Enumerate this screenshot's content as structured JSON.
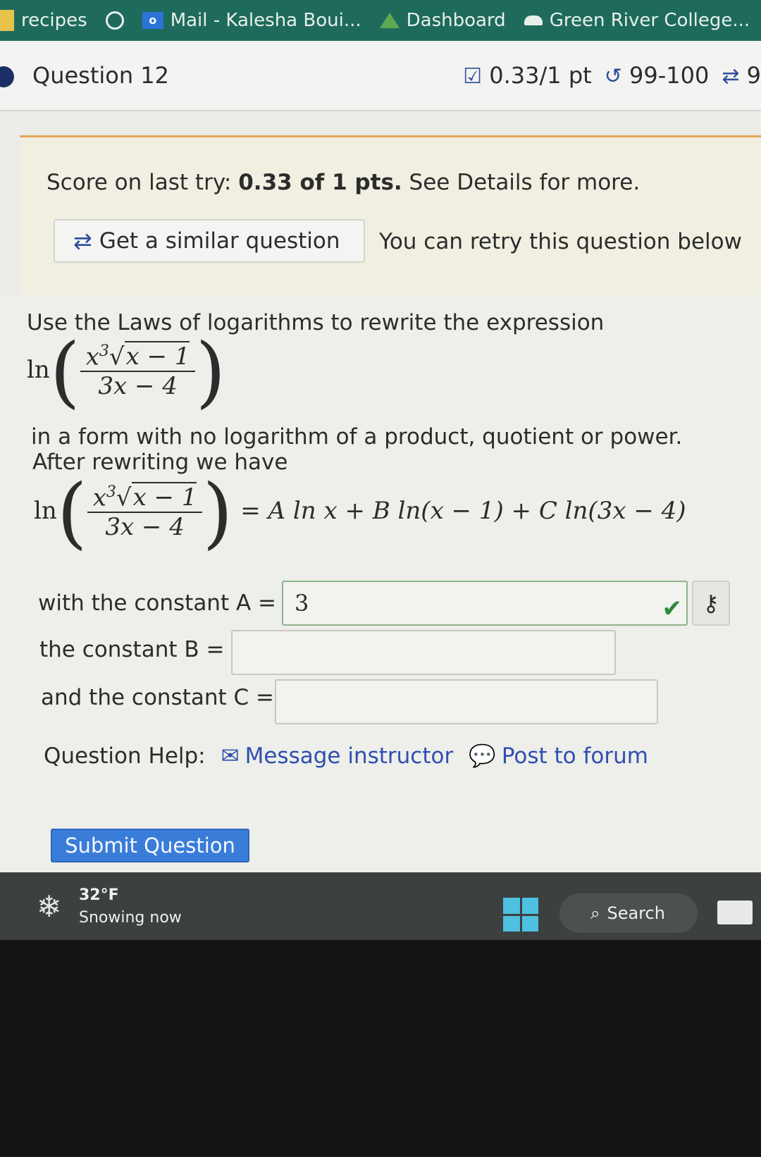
{
  "bookmarks": [
    {
      "label": "recipes",
      "icon": "folder-icon"
    },
    {
      "label": "",
      "icon": "circle-icon"
    },
    {
      "label": "Mail - Kalesha Boui...",
      "icon": "outlook-icon"
    },
    {
      "label": "Dashboard",
      "icon": "canvas-icon"
    },
    {
      "label": "Green River College...",
      "icon": "cloud-icon"
    }
  ],
  "question": {
    "title": "Question 12",
    "score": "0.33/1 pt",
    "attempts": "99-100",
    "retries": "9"
  },
  "score_box": {
    "prefix": "Score on last try: ",
    "score_bold": "0.33 of 1 pts.",
    "suffix": " See Details for more.",
    "similar_button": "Get a similar question",
    "retry_text": "You can retry this question below"
  },
  "problem": {
    "intro": "Use the Laws of logarithms to rewrite the expression",
    "ln": "ln",
    "numerator": "x",
    "numerator_exp": "3",
    "sqrt_content": "x − 1",
    "denominator": "3x − 4",
    "line2": "in a form with no logarithm of a product, quotient or power.",
    "line3": "After rewriting we have",
    "rhs": "= A ln x + B ln(x − 1) + C ln(3x − 4)",
    "label_a": "with the constant A =",
    "value_a": "3",
    "label_b": "the constant B =",
    "value_b": "",
    "label_c": "and the constant C =",
    "value_c": ""
  },
  "help": {
    "label": "Question Help:",
    "message": "Message instructor",
    "forum": "Post to forum"
  },
  "submit_label": "Submit Question",
  "taskbar": {
    "temperature": "32°F",
    "condition": "Snowing now",
    "search_label": "Search"
  },
  "colors": {
    "bookmark_bar": "#1e6b5c",
    "accent": "#3a7dd8",
    "link": "#2f4fb0",
    "score_border": "#e2a658"
  }
}
